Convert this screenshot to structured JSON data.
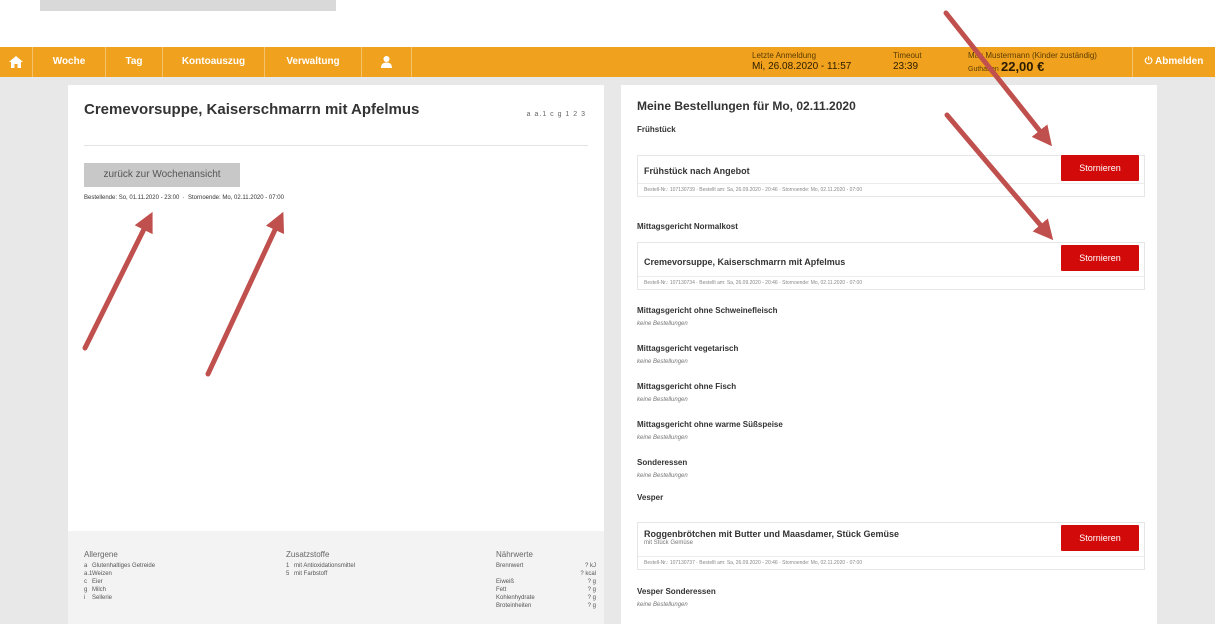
{
  "nav": {
    "home_icon": "home-icon",
    "items": [
      "Woche",
      "Tag",
      "Kontoauszug",
      "Verwaltung"
    ],
    "user_icon": "user-icon",
    "last_login_label": "Letzte Anmeldung",
    "last_login_value": "Mi, 26.08.2020 - 11:57",
    "timeout_label": "Timeout",
    "timeout_value": "23:39",
    "user_label": "Max Mustermann (Kinder zuständig)",
    "balance_label": "Guthaben",
    "balance_value": "22,00 €",
    "logout": "Abmelden"
  },
  "left": {
    "title": "Cremevorsuppe, Kaiserschmarrn mit Apfelmus",
    "allergen_codes": "a a.1 c g 1 2 3",
    "back_button": "zurück zur Wochenansicht",
    "deadline_order": "Bestellende: So, 01.11.2020 - 23:00",
    "deadline_cancel": "Stornoende: Mo, 02.11.2020 - 07:00",
    "separator": "·",
    "legend": {
      "allergens_title": "Allergene",
      "allergens": [
        {
          "code": "a",
          "label": "Glutenhaltiges Getreide"
        },
        {
          "code": "a.1",
          "label": "Weizen"
        },
        {
          "code": "c",
          "label": "Eier"
        },
        {
          "code": "g",
          "label": "Milch"
        },
        {
          "code": "i",
          "label": "Sellerie"
        }
      ],
      "additives_title": "Zusatzstoffe",
      "additives": [
        {
          "code": "1",
          "label": "mit Antioxidationsmittel"
        },
        {
          "code": "5",
          "label": "mit Farbstoff"
        }
      ],
      "nutrition_title": "Nährwerte",
      "nutrition": [
        {
          "label": "Brennwert",
          "value": "? kJ"
        },
        {
          "label": "",
          "value": "? kcal"
        },
        {
          "label": "Eiweiß",
          "value": "? g"
        },
        {
          "label": "Fett",
          "value": "? g"
        },
        {
          "label": "Kohlenhydrate",
          "value": "? g"
        },
        {
          "label": "Broteinheiten",
          "value": "? g"
        }
      ]
    }
  },
  "right": {
    "title": "Meine Bestellungen für Mo, 02.11.2020",
    "no_orders": "keine Bestellungen",
    "storno": "Stornieren",
    "sections": {
      "fruehstueck": "Frühstück",
      "normalkost": "Mittagsgericht Normalkost",
      "ohne_schwein": "Mittagsgericht ohne Schweinefleisch",
      "vegetarisch": "Mittagsgericht vegetarisch",
      "ohne_fisch": "Mittagsgericht ohne Fisch",
      "ohne_suess": "Mittagsgericht ohne warme Süßspeise",
      "sonderessen": "Sonderessen",
      "vesper": "Vesper",
      "vesper_sonder": "Vesper Sonderessen"
    },
    "orders": {
      "o1": {
        "name": "Frühstück nach Angebot",
        "meta": "Bestell-Nr.: 107130739 · Bestellt am: Sa, 26.09.2020 - 20:46 · Stornoende: Mo, 02.11.2020 - 07:00"
      },
      "o2": {
        "name": "Cremevorsuppe, Kaiserschmarrn mit Apfelmus",
        "meta": "Bestell-Nr.: 107130734 · Bestellt am: Sa, 26.09.2020 - 20:46 · Stornoende: Mo, 02.11.2020 - 07:00"
      },
      "o3": {
        "name": "Roggenbrötchen mit Butter und Maasdamer, Stück Gemüse",
        "sub": "mit Stück Gemüse",
        "meta": "Bestell-Nr.: 107130737 · Bestellt am: Sa, 26.09.2020 - 20:46 · Stornoende: Mo, 02.11.2020 - 07:00"
      }
    }
  },
  "colors": {
    "nav_bg": "#f0a21e",
    "storno_bg": "#d20a0a",
    "arrow": "#c0504d"
  }
}
